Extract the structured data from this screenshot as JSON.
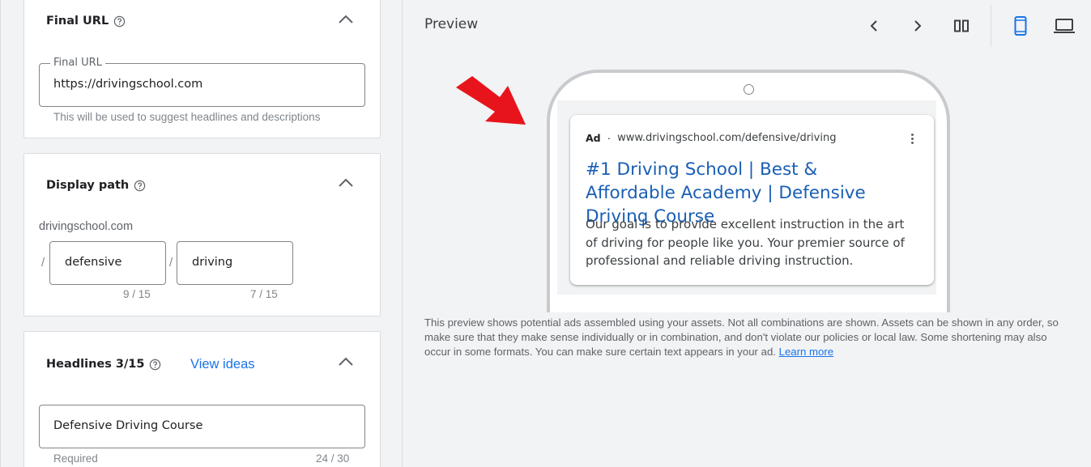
{
  "final_url_card": {
    "title": "Final URL",
    "field_label": "Final URL",
    "field_value": "https://drivingschool.com",
    "hint": "This will be used to suggest headlines and descriptions"
  },
  "display_path_card": {
    "title": "Display path",
    "domain": "drivingschool.com",
    "separator": "/",
    "path1": {
      "value": "defensive",
      "counter": "9 / 15"
    },
    "path2": {
      "value": "driving",
      "counter": "7 / 15"
    }
  },
  "headlines_card": {
    "title": "Headlines 3/15",
    "view_ideas": "View ideas",
    "headline1": {
      "value": "Defensive Driving Course",
      "hint": "Required",
      "counter": "24 / 30"
    }
  },
  "preview": {
    "title": "Preview",
    "ad": {
      "badge": "Ad",
      "dot": "·",
      "url": "www.drivingschool.com/defensive/driving",
      "headline": "#1 Driving School | Best & Affordable Academy | Defensive Driving Course",
      "description": "Our goal is to provide excellent instruction in the art of driving for people like you. Your premier source of professional and reliable driving instruction."
    },
    "disclaimer": "This preview shows potential ads assembled using your assets. Not all combinations are shown. Assets can be shown in any order, so make sure that they make sense individually or in combination, and don't violate our policies or local law. Some shortening may also occur in some formats. You can make sure certain text appears in your ad.",
    "learn_more": "Learn more"
  },
  "colors": {
    "accent": "#1a73e8",
    "headline_link": "#1a5fb4",
    "arrow": "#e8141b"
  },
  "icons": {
    "help": "help-circle-icon",
    "collapse": "chevron-up-icon",
    "prev": "chevron-left-icon",
    "next": "chevron-right-icon",
    "columns": "column-view-icon",
    "mobile": "smartphone-icon",
    "desktop": "laptop-icon",
    "more": "more-vert-icon"
  }
}
